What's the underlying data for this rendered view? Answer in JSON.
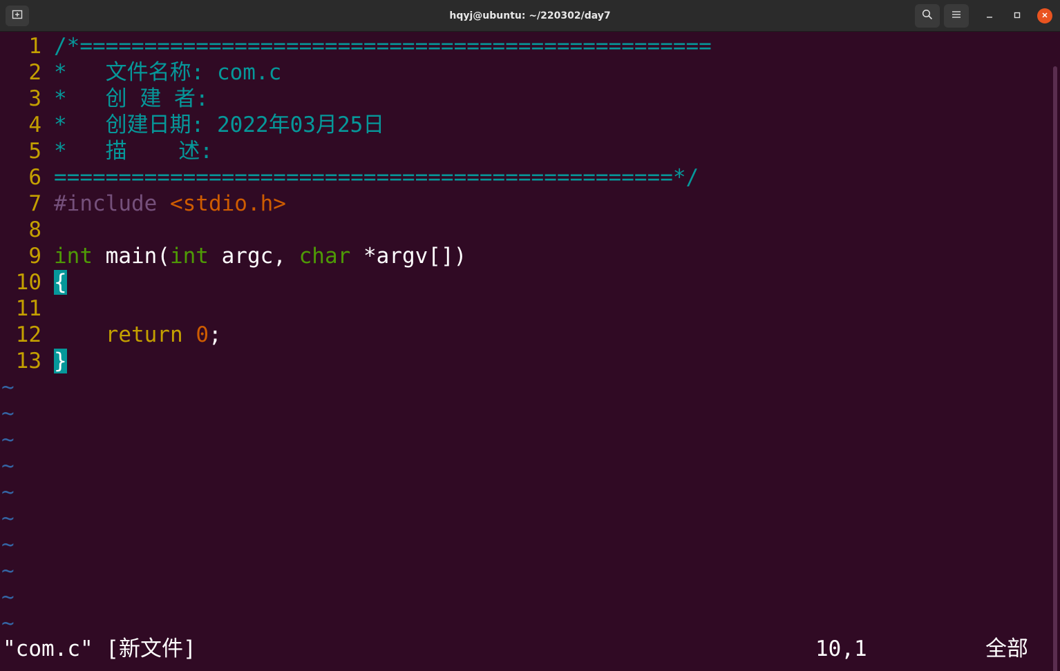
{
  "window": {
    "title": "hqyj@ubuntu: ~/220302/day7",
    "new_tab_icon": "new-tab-icon",
    "search_icon": "search-icon",
    "menu_icon": "hamburger-menu-icon",
    "minimize_icon": "minimize-icon",
    "maximize_icon": "maximize-icon",
    "close_icon": "close-icon",
    "close_color": "#e95420"
  },
  "editor": {
    "background": "#300a24",
    "lines": [
      {
        "num": "1",
        "parts": [
          {
            "t": "/*=================================================",
            "c": "c-comment"
          }
        ]
      },
      {
        "num": "2",
        "parts": [
          {
            "t": "*   文件名称: com.c",
            "c": "c-comment"
          }
        ]
      },
      {
        "num": "3",
        "parts": [
          {
            "t": "*   创 建 者:",
            "c": "c-comment"
          }
        ]
      },
      {
        "num": "4",
        "parts": [
          {
            "t": "*   创建日期: 2022年03月25日",
            "c": "c-comment"
          }
        ]
      },
      {
        "num": "5",
        "parts": [
          {
            "t": "*   描    述:",
            "c": "c-comment"
          }
        ]
      },
      {
        "num": "6",
        "parts": [
          {
            "t": "================================================*/",
            "c": "c-comment"
          }
        ]
      },
      {
        "num": "7",
        "parts": [
          {
            "t": "#include ",
            "c": "c-pre"
          },
          {
            "t": "<stdio.h>",
            "c": "c-inc"
          }
        ]
      },
      {
        "num": "8",
        "parts": []
      },
      {
        "num": "9",
        "parts": [
          {
            "t": "int",
            "c": "c-type"
          },
          {
            "t": " main(",
            "c": "c-plain"
          },
          {
            "t": "int",
            "c": "c-type"
          },
          {
            "t": " argc, ",
            "c": "c-plain"
          },
          {
            "t": "char",
            "c": "c-type"
          },
          {
            "t": " *argv[])",
            "c": "c-plain"
          }
        ]
      },
      {
        "num": "10",
        "parts": [
          {
            "t": "{",
            "c": "brace-hl"
          }
        ]
      },
      {
        "num": "11",
        "parts": []
      },
      {
        "num": "12",
        "parts": [
          {
            "t": "    ",
            "c": "c-plain"
          },
          {
            "t": "return",
            "c": "c-kw"
          },
          {
            "t": " ",
            "c": "c-plain"
          },
          {
            "t": "0",
            "c": "c-num"
          },
          {
            "t": ";",
            "c": "c-plain"
          }
        ]
      },
      {
        "num": "13",
        "parts": [
          {
            "t": "}",
            "c": "brace-hl"
          }
        ]
      }
    ],
    "tilde_char": "~",
    "tilde_count": 10
  },
  "statusbar": {
    "file_msg": "\"com.c\" [新文件]",
    "cursor_pos": "10,1",
    "scroll_pct": "全部"
  }
}
